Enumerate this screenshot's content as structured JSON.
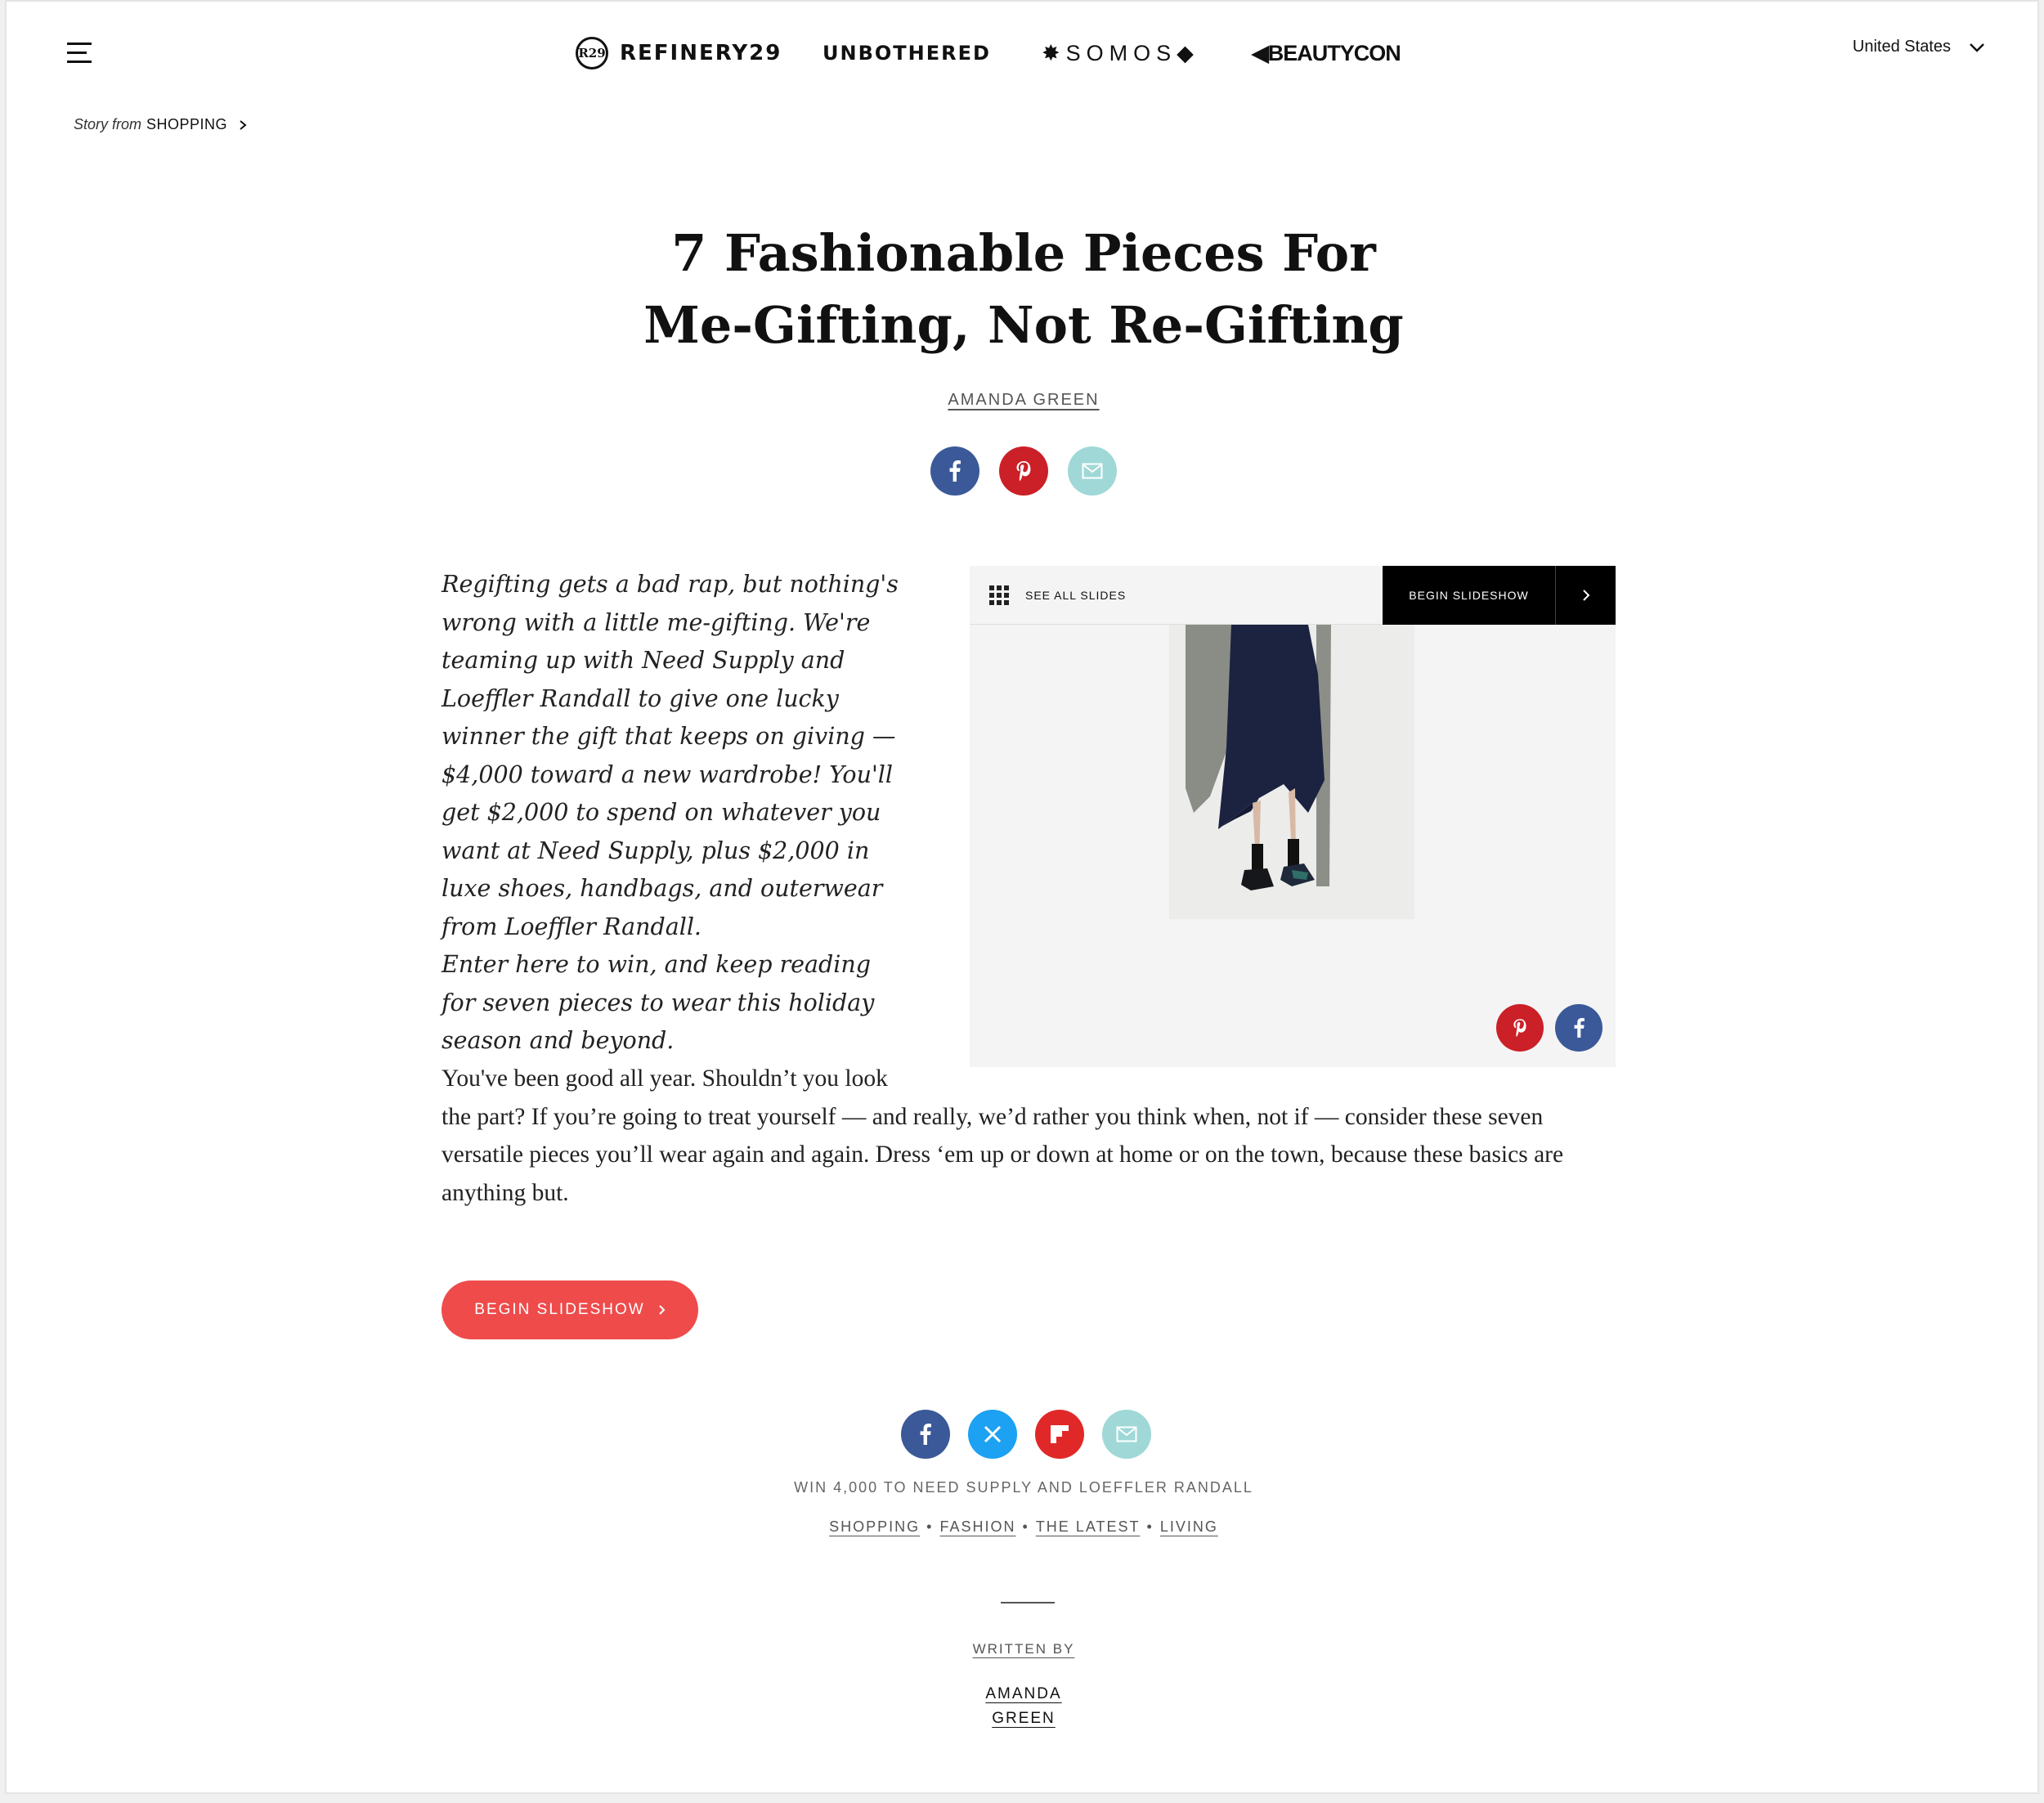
{
  "header": {
    "menu_icon": "hamburger-menu-icon",
    "brands": {
      "refinery29": "REFINERY29",
      "refinery29_logo": "R29",
      "unbothered": "UNBOTHERED",
      "somos": "✸SOMOS◆",
      "beautycon": "◀BEAUTYCON"
    },
    "country": "United States",
    "country_icon": "chevron-down-icon"
  },
  "breadcrumb": {
    "prefix": "Story from",
    "section": "SHOPPING",
    "icon": "chevron-right-icon"
  },
  "article": {
    "title_line1": "7 Fashionable Pieces For",
    "title_line2": "Me-Gifting, Not Re-Gifting",
    "author": "AMANDA GREEN",
    "intro": "Regifting gets a bad rap, but nothing's wrong with a little me-gifting. We're teaming up with Need Supply and Loeffler Randall to give one lucky winner the gift that keeps on giving — $4,000 toward a new wardrobe! You'll get $2,000 to spend on whatever you want at Need Supply, plus $2,000 in luxe shoes, handbags, and outerwear from Loeffler Randall.",
    "intro_line2": "Enter here to win, and keep reading for seven pieces to wear this holiday season and beyond.",
    "body_line1": "You've been good all year. Shouldn’t you look",
    "body_rest": "the part? If you’re going to treat yourself — and really, we’d rather you think when, not if — consider these seven versatile pieces you’ll wear again and again. Dress ‘em up or down at home or on the town, because these basics are anything but.",
    "cta": "BEGIN SLIDESHOW",
    "tagline": "WIN 4,000 TO NEED SUPPLY AND LOEFFLER RANDALL",
    "tags": [
      "SHOPPING",
      "FASHION",
      "THE LATEST",
      "LIVING"
    ],
    "tag_separator": "•",
    "written_by": "WRITTEN BY",
    "author_first": "AMANDA",
    "author_last": "GREEN"
  },
  "slideshow": {
    "see_all": "SEE ALL SLIDES",
    "begin": "BEGIN SLIDESHOW",
    "grid_icon": "grid-icon",
    "next_icon": "chevron-right-icon"
  },
  "share": {
    "top": [
      "facebook-icon",
      "pinterest-icon",
      "email-icon"
    ],
    "bottom": [
      "facebook-icon",
      "x-twitter-icon",
      "flipboard-icon",
      "email-icon"
    ]
  },
  "colors": {
    "facebook": "#3b5998",
    "pinterest": "#cb2027",
    "email": "#9fd8d7",
    "twitter": "#1da1f2",
    "flipboard": "#e12828",
    "cta": "#ef4b4b"
  }
}
